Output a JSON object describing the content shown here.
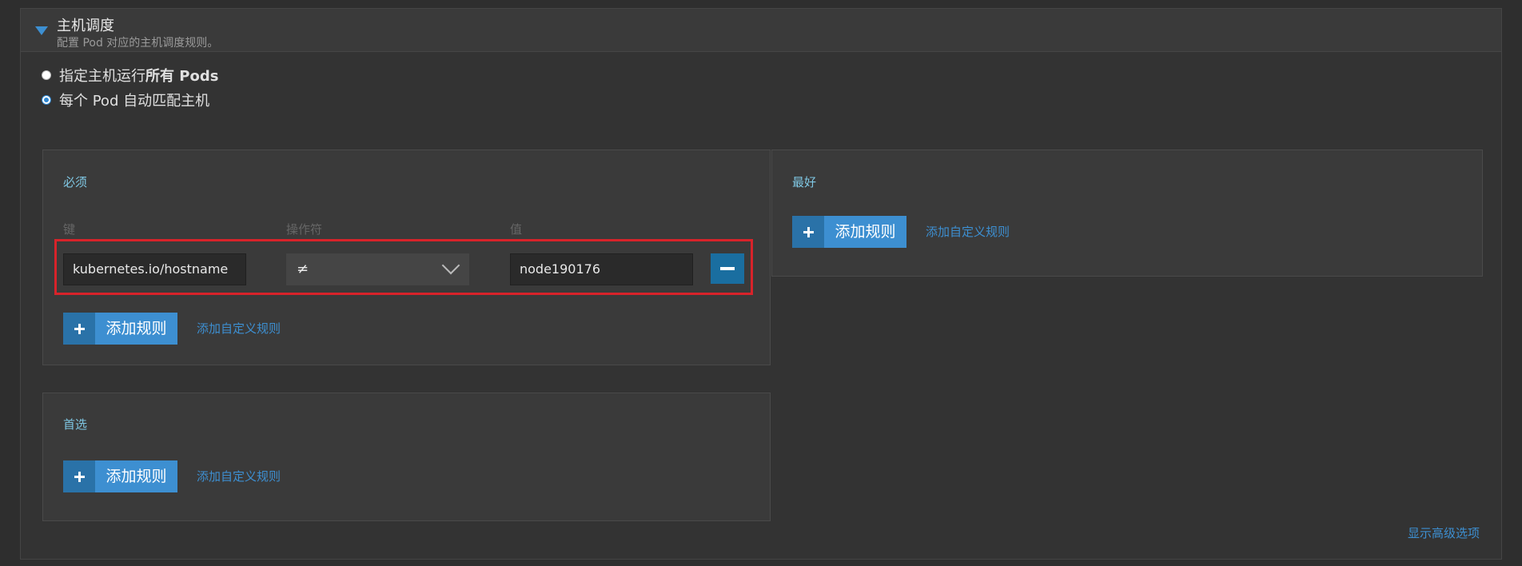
{
  "section": {
    "title": "主机调度",
    "subtitle": "配置 Pod 对应的主机调度规则。"
  },
  "options": [
    {
      "prefix": "指定主机运行",
      "bold": "所有 Pods",
      "selected": false
    },
    {
      "label": "每个 Pod 自动匹配主机",
      "selected": true
    }
  ],
  "required": {
    "title": "必须",
    "columns": {
      "key": "键",
      "operator": "操作符",
      "value": "值"
    },
    "rules": [
      {
        "key": "kubernetes.io/hostname",
        "operator": "≠",
        "value": "node190176"
      }
    ],
    "add_rule": "添加规则",
    "add_custom_rule": "添加自定义规则"
  },
  "preferred": {
    "title": "首选",
    "add_rule": "添加规则",
    "add_custom_rule": "添加自定义规则"
  },
  "best": {
    "title": "最好",
    "add_rule": "添加规则",
    "add_custom_rule": "添加自定义规则"
  },
  "advanced_link": "显示高级选项",
  "colors": {
    "accent": "#3d8fd1",
    "highlight": "#d8232a",
    "label": "#7fc7e3"
  }
}
